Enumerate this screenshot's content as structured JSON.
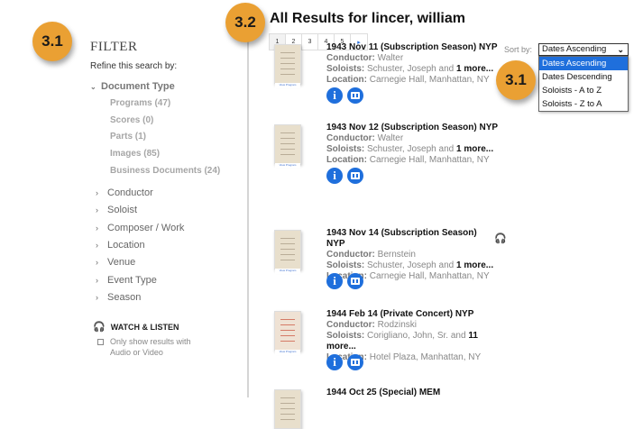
{
  "badges": [
    "3.1",
    "3.2",
    "3.1"
  ],
  "filter": {
    "title": "FILTER",
    "refine": "Refine this search by:",
    "document_type": {
      "label": "Document Type",
      "items": [
        "Programs (47)",
        "Scores (0)",
        "Parts (1)",
        "Images (85)",
        "Business Documents (24)"
      ]
    },
    "facets": [
      "Conductor",
      "Soloist",
      "Composer / Work",
      "Location",
      "Venue",
      "Event Type",
      "Season"
    ],
    "watch": {
      "label": "WATCH & LISTEN",
      "checkbox": "Only show results with Audio or Video",
      "checked": false
    }
  },
  "main": {
    "title": "All Results for lincer, william",
    "pages": [
      "1",
      "2",
      "3",
      "4",
      "5",
      "▸"
    ],
    "sort": {
      "label": "Sort by:",
      "selected": "Dates Ascending",
      "options": [
        "Dates Ascending",
        "Dates Descending",
        "Soloists - A to Z",
        "Soloists - Z to A"
      ]
    },
    "labels": {
      "conductor": "Conductor:",
      "soloists": "Soloists:",
      "location": "Location:",
      "thumb_caption": "View Program"
    },
    "results": [
      {
        "title": "1943 Nov 11 (Subscription Season) NYP",
        "conductor": "Walter",
        "soloists": "Schuster, Joseph and",
        "more": "1 more...",
        "location": "Carnegie Hall, Manhattan, NY"
      },
      {
        "title": "1943 Nov 12 (Subscription Season) NYP",
        "conductor": "Walter",
        "soloists": "Schuster, Joseph and",
        "more": "1 more...",
        "location": "Carnegie Hall, Manhattan, NY"
      },
      {
        "title": "1943 Nov 14 (Subscription Season) NYP",
        "conductor": "Bernstein",
        "soloists": "Schuster, Joseph and",
        "more": "1 more...",
        "location": "Carnegie Hall, Manhattan, NY",
        "audio": true
      },
      {
        "title": "1944 Feb 14 (Private Concert) NYP",
        "conductor": "Rodzinski",
        "soloists": "Corigliano, John, Sr. and",
        "more": "11 more...",
        "location": "Hotel Plaza, Manhattan, NY"
      },
      {
        "title": "1944 Oct 25 (Special) MEM"
      }
    ]
  },
  "colors": {
    "badge": "#eaa033",
    "accent": "#1f6fdc"
  }
}
